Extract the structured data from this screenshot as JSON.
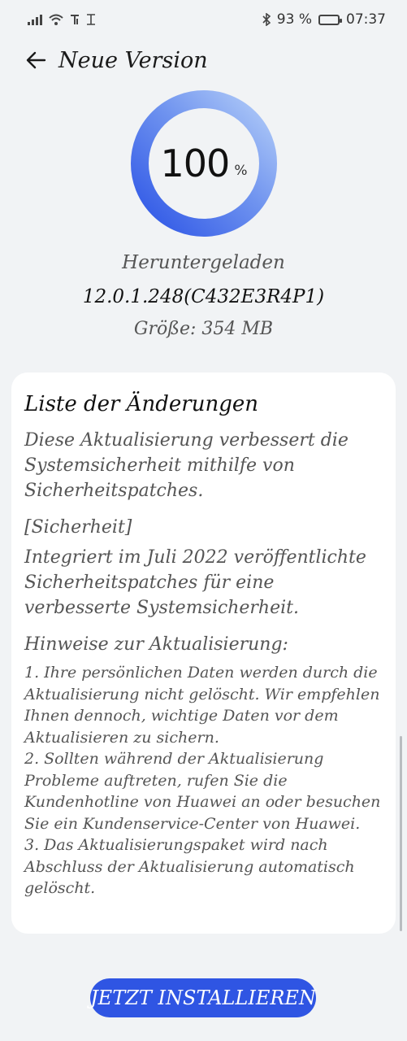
{
  "status_bar": {
    "battery_percent": "93 %",
    "time": "07:37",
    "battery_level": 0.93,
    "icons": [
      "signal-icon",
      "wifi-icon",
      "nfc-icon",
      "data-icon",
      "bluetooth-icon",
      "battery-icon"
    ]
  },
  "header": {
    "title": "Neue Version",
    "back_icon": "arrow-left-icon"
  },
  "progress": {
    "value": "100",
    "unit": "%",
    "fraction": 1.0,
    "status": "Heruntergeladen"
  },
  "package": {
    "version": "12.0.1.248(C432E3R4P1)",
    "size": "Größe: 354 MB"
  },
  "changelog": {
    "title": "Liste der Änderungen",
    "intro": "Diese Aktualisierung verbessert die Systemsicherheit mithilfe von Sicherheitspatches.",
    "security_tag": "[Sicherheit]",
    "security_text": "Integriert im Juli 2022 veröffentlichte Sicherheitspatches für eine verbesserte Systemsicherheit.",
    "notes_title": "Hinweise zur Aktualisierung:",
    "notes": [
      "1. Ihre persönlichen Daten werden durch die Aktualisierung nicht gelöscht. Wir empfehlen Ihnen dennoch, wichtige Daten vor dem Aktualisieren zu sichern.",
      "2. Sollten während der Aktualisierung Probleme auftreten, rufen Sie die Kundenhotline von Huawei an oder besuchen Sie ein Kundenservice-Center von Huawei.",
      "3. Das Aktualisierungspaket wird nach Abschluss der Aktualisierung automatisch gelöscht."
    ]
  },
  "actions": {
    "install_label": "JETZT INSTALLIEREN"
  },
  "colors": {
    "accent": "#2f55e3",
    "ring_start": "#3a5ee6",
    "ring_end": "#a9c6f8",
    "background": "#f1f3f5"
  }
}
